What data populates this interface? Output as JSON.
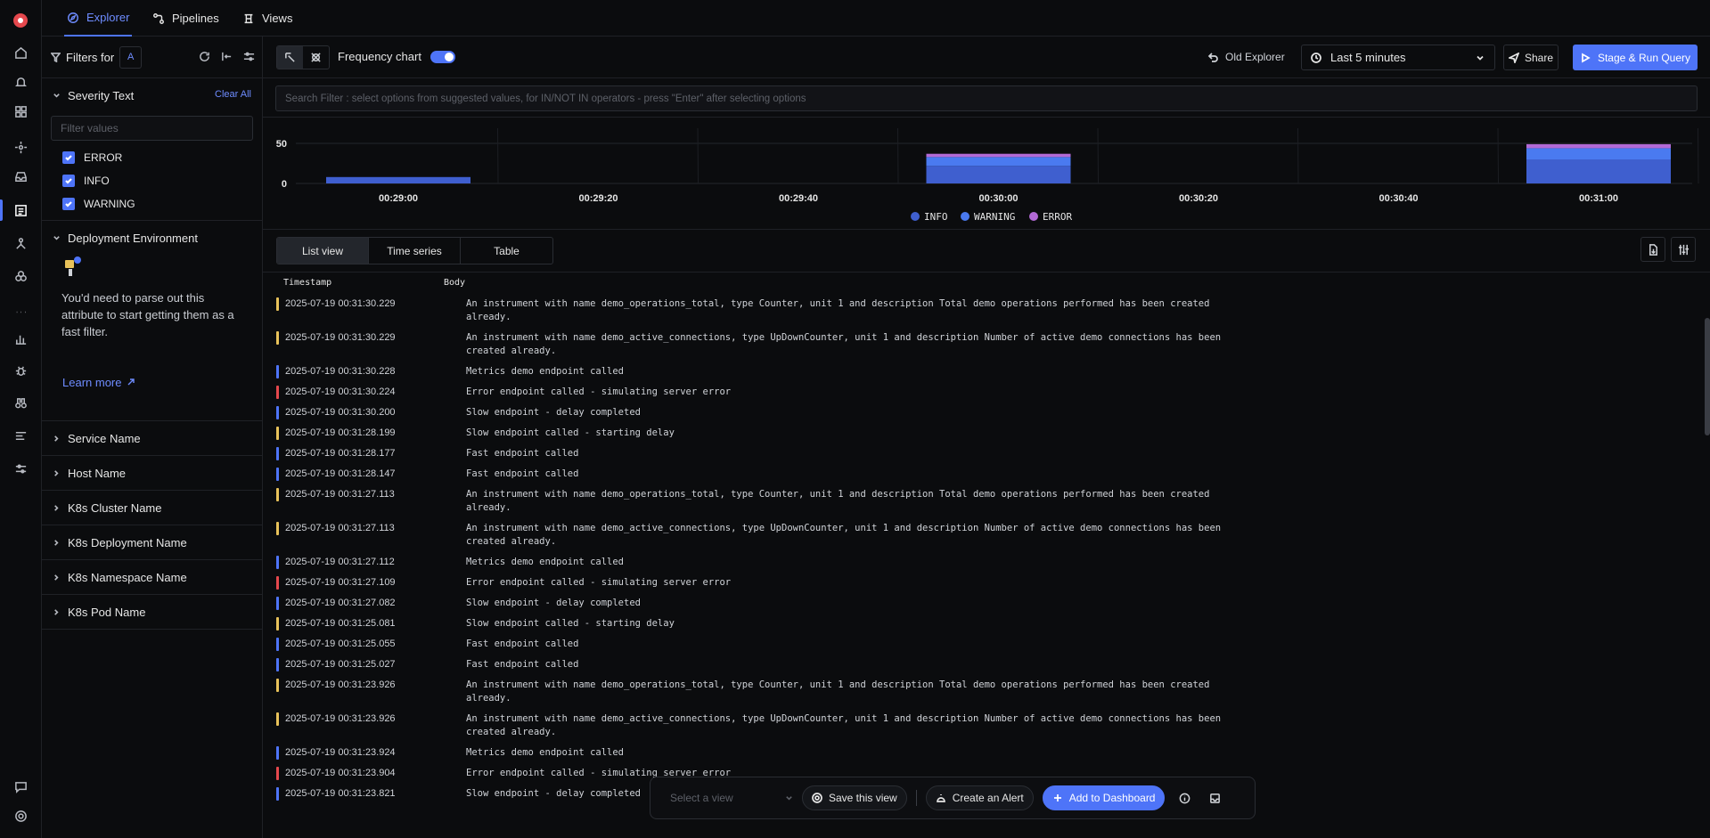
{
  "nav": {
    "tabs": [
      {
        "label": "Explorer",
        "icon": "compass-icon"
      },
      {
        "label": "Pipelines",
        "icon": "pipeline-icon"
      },
      {
        "label": "Views",
        "icon": "views-icon"
      }
    ]
  },
  "filters": {
    "title": "Filters for",
    "query_letter": "A",
    "severity": {
      "title": "Severity Text",
      "clear_label": "Clear All",
      "search_placeholder": "Filter values",
      "options": [
        "ERROR",
        "INFO",
        "WARNING"
      ]
    },
    "deployment": {
      "title": "Deployment Environment",
      "message": "You'd need to parse out this attribute to start getting them as a fast filter.",
      "learn_more": "Learn more"
    },
    "collapsed_sections": [
      "Service Name",
      "Host Name",
      "K8s Cluster Name",
      "K8s Deployment Name",
      "K8s Namespace Name",
      "K8s Pod Name"
    ]
  },
  "toolbar": {
    "frequency_label": "Frequency chart",
    "frequency_enabled": true,
    "old_explorer": "Old Explorer",
    "time_range": "Last 5 minutes",
    "share": "Share",
    "run": "Stage & Run Query"
  },
  "search": {
    "placeholder": "Search Filter : select options from suggested values, for IN/NOT IN operators - press \"Enter\" after selecting options"
  },
  "chart_data": {
    "type": "bar",
    "stacked": true,
    "y_ticks": [
      0,
      50
    ],
    "ylim": [
      0,
      60
    ],
    "x_ticks": [
      "00:29:00",
      "00:29:20",
      "00:29:40",
      "00:30:00",
      "00:30:20",
      "00:30:40",
      "00:31:00"
    ],
    "categories": [
      "00:29:00",
      "00:30:00",
      "00:31:00"
    ],
    "series": [
      {
        "name": "INFO",
        "color": "#3f5fcf",
        "values": [
          8,
          22,
          30
        ]
      },
      {
        "name": "WARNING",
        "color": "#4a7af0",
        "values": [
          0,
          11,
          14
        ]
      },
      {
        "name": "ERROR",
        "color": "#b36ad6",
        "values": [
          0,
          4,
          5
        ]
      }
    ],
    "legend": "bottom-center"
  },
  "views": {
    "tabs": [
      "List view",
      "Time series",
      "Table"
    ],
    "active": "List view"
  },
  "logs": {
    "columns": [
      "Timestamp",
      "Body"
    ],
    "severity_colors": {
      "INFO": "#4e74f8",
      "WARNING": "#e8c25a",
      "ERROR": "#e5484d"
    },
    "rows": [
      {
        "sev": "WARNING",
        "ts": "2025-07-19 00:31:30.229",
        "body": "An instrument with name demo_operations_total, type Counter, unit 1 and description Total demo operations performed has been created already."
      },
      {
        "sev": "WARNING",
        "ts": "2025-07-19 00:31:30.229",
        "body": "An instrument with name demo_active_connections, type UpDownCounter, unit 1 and description Number of active demo connections has been created already."
      },
      {
        "sev": "INFO",
        "ts": "2025-07-19 00:31:30.228",
        "body": "Metrics demo endpoint called"
      },
      {
        "sev": "ERROR",
        "ts": "2025-07-19 00:31:30.224",
        "body": "Error endpoint called - simulating server error"
      },
      {
        "sev": "INFO",
        "ts": "2025-07-19 00:31:30.200",
        "body": "Slow endpoint - delay completed"
      },
      {
        "sev": "WARNING",
        "ts": "2025-07-19 00:31:28.199",
        "body": "Slow endpoint called - starting delay"
      },
      {
        "sev": "INFO",
        "ts": "2025-07-19 00:31:28.177",
        "body": "Fast endpoint called"
      },
      {
        "sev": "INFO",
        "ts": "2025-07-19 00:31:28.147",
        "body": "Fast endpoint called"
      },
      {
        "sev": "WARNING",
        "ts": "2025-07-19 00:31:27.113",
        "body": "An instrument with name demo_operations_total, type Counter, unit 1 and description Total demo operations performed has been created already."
      },
      {
        "sev": "WARNING",
        "ts": "2025-07-19 00:31:27.113",
        "body": "An instrument with name demo_active_connections, type UpDownCounter, unit 1 and description Number of active demo connections has been created already."
      },
      {
        "sev": "INFO",
        "ts": "2025-07-19 00:31:27.112",
        "body": "Metrics demo endpoint called"
      },
      {
        "sev": "ERROR",
        "ts": "2025-07-19 00:31:27.109",
        "body": "Error endpoint called - simulating server error"
      },
      {
        "sev": "INFO",
        "ts": "2025-07-19 00:31:27.082",
        "body": "Slow endpoint - delay completed"
      },
      {
        "sev": "WARNING",
        "ts": "2025-07-19 00:31:25.081",
        "body": "Slow endpoint called - starting delay"
      },
      {
        "sev": "INFO",
        "ts": "2025-07-19 00:31:25.055",
        "body": "Fast endpoint called"
      },
      {
        "sev": "INFO",
        "ts": "2025-07-19 00:31:25.027",
        "body": "Fast endpoint called"
      },
      {
        "sev": "WARNING",
        "ts": "2025-07-19 00:31:23.926",
        "body": "An instrument with name demo_operations_total, type Counter, unit 1 and description Total demo operations performed has been created already."
      },
      {
        "sev": "WARNING",
        "ts": "2025-07-19 00:31:23.926",
        "body": "An instrument with name demo_active_connections, type UpDownCounter, unit 1 and description Number of active demo connections has been created already."
      },
      {
        "sev": "INFO",
        "ts": "2025-07-19 00:31:23.924",
        "body": "Metrics demo endpoint called"
      },
      {
        "sev": "ERROR",
        "ts": "2025-07-19 00:31:23.904",
        "body": "Error endpoint called - simulating server error"
      },
      {
        "sev": "INFO",
        "ts": "2025-07-19 00:31:23.821",
        "body": "Slow endpoint - delay completed"
      }
    ]
  },
  "actions": {
    "select_view_placeholder": "Select a view",
    "save_view": "Save this view",
    "create_alert": "Create an Alert",
    "add_dashboard": "Add to Dashboard"
  }
}
